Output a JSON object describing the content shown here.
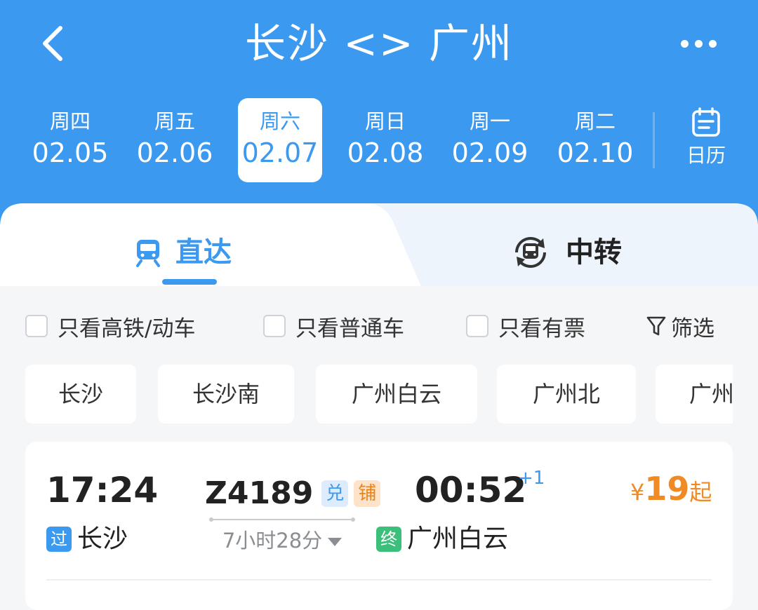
{
  "header": {
    "title": "长沙 <> 广州"
  },
  "dates": [
    {
      "weekday": "周四",
      "date": "02.05",
      "active": false
    },
    {
      "weekday": "周五",
      "date": "02.06",
      "active": false
    },
    {
      "weekday": "周六",
      "date": "02.07",
      "active": true
    },
    {
      "weekday": "周日",
      "date": "02.08",
      "active": false
    },
    {
      "weekday": "周一",
      "date": "02.09",
      "active": false
    },
    {
      "weekday": "周二",
      "date": "02.10",
      "active": false
    }
  ],
  "calendar": {
    "label": "日历"
  },
  "tabs": {
    "direct": "直达",
    "transfer": "中转"
  },
  "filters": {
    "high_speed": "只看高铁/动车",
    "normal": "只看普通车",
    "available": "只看有票",
    "filter_btn": "筛选"
  },
  "stations": [
    "长沙",
    "长沙南",
    "广州白云",
    "广州北",
    "广州"
  ],
  "train": {
    "dep_time": "17:24",
    "dep_tag": "过",
    "dep_station": "长沙",
    "number": "Z4189",
    "badge_exchange": "兑",
    "badge_berth": "铺",
    "duration": "7小时28分",
    "arr_time": "00:52",
    "arr_plus": "+1",
    "arr_tag": "终",
    "arr_station": "广州白云",
    "price_currency": "¥",
    "price_amount": "19",
    "price_suffix": "起"
  },
  "colors": {
    "primary": "#3b99f0",
    "price": "#f08a24",
    "terminal_tag": "#3dbf7c"
  }
}
